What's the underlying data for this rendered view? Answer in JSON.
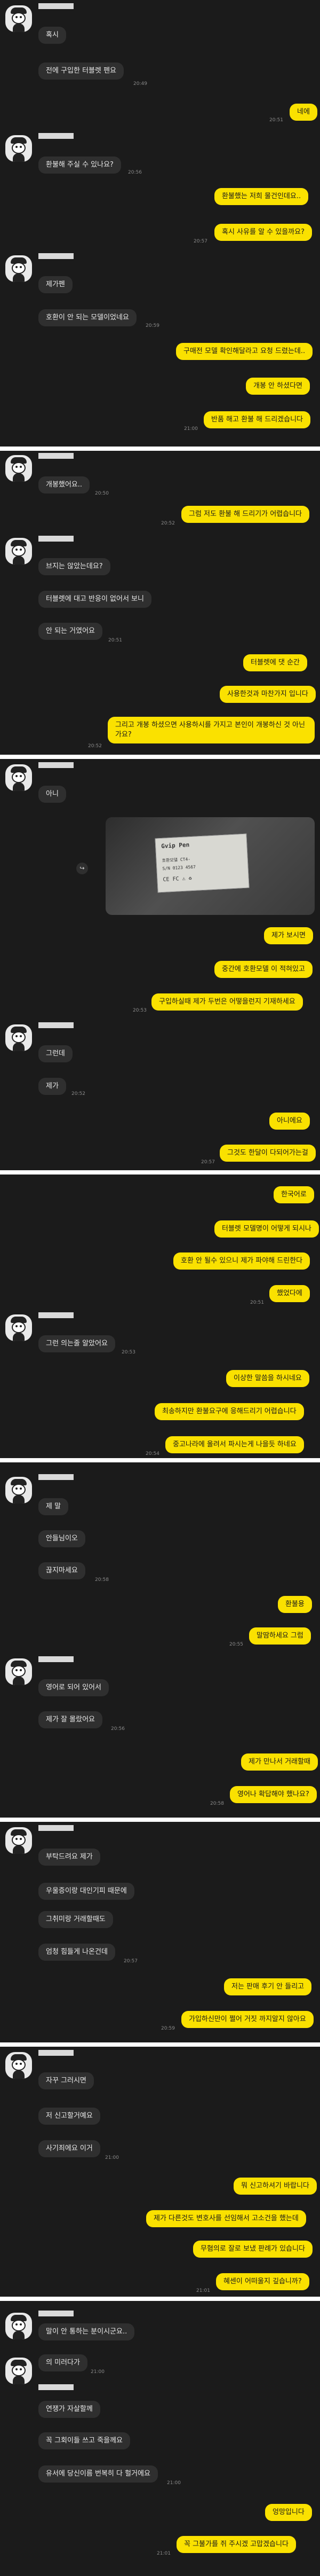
{
  "panels": [
    {
      "messages": [
        {
          "text": "혹시",
          "side": "in"
        },
        {
          "text": "전에 구입한 터블렛 펜요",
          "side": "in",
          "time": "20:49"
        },
        {
          "text": "네에",
          "side": "out",
          "time": "20:51"
        },
        {
          "text": "환불해 주실 수 있나요?",
          "side": "in",
          "time": "20:56"
        },
        {
          "text": "환불했는 저희 물건인데요..",
          "side": "out"
        },
        {
          "text": "혹시 사유를 알 수 있을까요?",
          "side": "out",
          "time": "20:57"
        },
        {
          "text": "제가펜",
          "side": "in"
        },
        {
          "text": "호환이 안 되는 모델이었네요",
          "side": "in",
          "time": "20:59"
        },
        {
          "text": "구매전 모델 확인해달라고 요청 드렸는데..",
          "side": "out"
        },
        {
          "text": "개봉 안 하셨다면",
          "side": "out"
        },
        {
          "text": "반품 해고 환불 해 드리겠습니다",
          "side": "out",
          "time": "21:00"
        }
      ]
    },
    {
      "messages": [
        {
          "text": "개봉했어요..",
          "side": "in",
          "time": "20:50"
        },
        {
          "text": "그럼 저도 환불 해 드리기가 어렵습니다",
          "side": "out",
          "time": "20:52"
        },
        {
          "text": "브지는 않았는데요?",
          "side": "in"
        },
        {
          "text": "터블렛에 대고 반응이 없어서 보니",
          "side": "in"
        },
        {
          "text": "안 되는 거였어요",
          "side": "in",
          "time": "20:51"
        },
        {
          "text": "터블렛에 댓 순간",
          "side": "out"
        },
        {
          "text": "사용한것과 마찬가지 입니다",
          "side": "out"
        },
        {
          "text": "그리고 개봉 하셨으면 사용하시를 가지고 본인이 개봉하신 것 아닌가요?",
          "side": "out",
          "time": "20:52"
        }
      ]
    },
    {
      "messages": [
        {
          "text": "아니",
          "side": "in"
        },
        {
          "text": "제가 보시면",
          "side": "out"
        },
        {
          "text": "중간에 호환모델 이 적혀있고",
          "side": "out"
        },
        {
          "text": "구입하실때 제가 두번은 어떻을런지 기재하세요",
          "side": "out",
          "time": "20:53"
        },
        {
          "text": "그런데",
          "side": "in"
        },
        {
          "text": "제가",
          "side": "in",
          "time": "20:52"
        },
        {
          "text": "아니에요",
          "side": "out"
        },
        {
          "text": "그것도 한달이 다되어가는걸",
          "side": "out",
          "time": "20:57"
        }
      ],
      "photo": {
        "brand": "Gvip Pen",
        "line1": "호환모델 CT4-",
        "line2": "S/N 0123 4567",
        "line3": "CE FC ⚠ ♻"
      }
    },
    {
      "messages": [
        {
          "text": "한국어로",
          "side": "out"
        },
        {
          "text": "터블렛 모델명이 어떻게 되시나",
          "side": "out"
        },
        {
          "text": "호환 안 될수 있으니 제가 파야해 드린한다",
          "side": "out"
        },
        {
          "text": "했었다에",
          "side": "out",
          "time": "20:51"
        },
        {
          "text": "그런 의는줄 알았어요",
          "side": "in",
          "time": "20:53"
        },
        {
          "text": "이상한 말씀을 하시네요",
          "side": "out"
        },
        {
          "text": "최송하지만 환불요구에 응해드리기 어렵습니다",
          "side": "out"
        },
        {
          "text": "중고나라에 올려서 파시는게 나을듯 하네요",
          "side": "out",
          "time": "20:54"
        }
      ]
    },
    {
      "messages": [
        {
          "text": "제 말",
          "side": "in"
        },
        {
          "text": "안들님이오",
          "side": "in"
        },
        {
          "text": "끊지마세요",
          "side": "in",
          "time": "20:58"
        },
        {
          "text": "환불용",
          "side": "out"
        },
        {
          "text": "말땀하세요 그럼",
          "side": "out",
          "time": "20:55"
        },
        {
          "text": "영어로 되어 있어서",
          "side": "in"
        },
        {
          "text": "제가 잘 몰랐어요",
          "side": "in",
          "time": "20:56"
        },
        {
          "text": "제가 만나서 거래할때",
          "side": "out"
        },
        {
          "text": "영어나 확답해야 했나요?",
          "side": "out",
          "time": "20:58"
        }
      ]
    },
    {
      "messages": [
        {
          "text": "부탁드려요 제가",
          "side": "in"
        },
        {
          "text": "우울증이랑 대인기피 때문에",
          "side": "in"
        },
        {
          "text": "그취미랑 거래할때도",
          "side": "in"
        },
        {
          "text": "엄청 힘들게 나온건데",
          "side": "in",
          "time": "20:57"
        },
        {
          "text": "저는 판매 후기 안 들리고",
          "side": "out"
        },
        {
          "text": "가입하신만이 쩔어 거짓 까지알지 않아요",
          "side": "out",
          "time": "20:59"
        }
      ]
    },
    {
      "messages": [
        {
          "text": "자꾸 그러시면",
          "side": "in"
        },
        {
          "text": "저 신고할거예요",
          "side": "in"
        },
        {
          "text": "사기죄에요 이거",
          "side": "in",
          "time": "21:00"
        },
        {
          "text": "뭐 신고하셔기 바랍니다",
          "side": "out"
        },
        {
          "text": "제가 다른것도 변호사를 선임해서 고소건을 했는데",
          "side": "out"
        },
        {
          "text": "무혐의로 잘로 보냈 판례가 있습니다",
          "side": "out"
        },
        {
          "text": "혜센이 어떠울지 깊습니까?",
          "side": "out",
          "time": "21:01"
        }
      ]
    },
    {
      "messages": [
        {
          "text": "말이 안 통하는 분이시군요..",
          "side": "in"
        },
        {
          "text": "의 미러다가",
          "side": "in",
          "time": "21:00"
        },
        {
          "text": "연쟁가 자살할께",
          "side": "in"
        },
        {
          "text": "꼭 그회이들 쓰고 죽을께요",
          "side": "in"
        },
        {
          "text": "유서에 당신이름 번복히 다 헐거에요",
          "side": "in",
          "time": "21:00"
        },
        {
          "text": "엉망입니다",
          "side": "out"
        },
        {
          "text": "꼭 그불가를 쥐 주시겠 고맙겠습니다",
          "side": "out",
          "time": "21:01"
        }
      ]
    }
  ]
}
